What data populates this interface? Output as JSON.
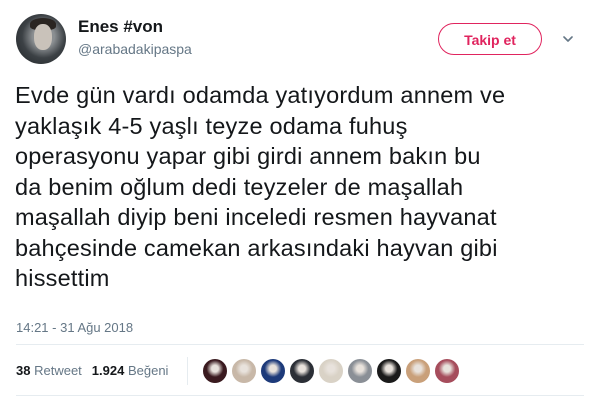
{
  "user": {
    "name": "Enes #von",
    "handle": "@arabadakipaspa"
  },
  "follow_label": "Takip et",
  "tweet_text": "Evde gün vardı odamda yatıyordum annem ve\nyaklaşık 4-5 yaşlı teyze odama fuhuş\noperasyonu yapar gibi girdi annem bakın bu\nda benim oğlum dedi teyzeler de maşallah\nmaşallah diyip beni inceledi resmen hayvanat\nbahçesinde camekan arkasındaki hayvan gibi\nhissettim",
  "timestamp": "14:21 - 31 Ağu 2018",
  "stats": {
    "retweets_count": "38",
    "retweets_label": "Retweet",
    "likes_count": "1.924",
    "likes_label": "Beğeni"
  },
  "likers": [
    {
      "color": "#3a1a1f"
    },
    {
      "color": "#c8b8a8"
    },
    {
      "color": "#1d3a7a"
    },
    {
      "color": "#2b2f36"
    },
    {
      "color": "#d9d2c6"
    },
    {
      "color": "#8a8f96"
    },
    {
      "color": "#1a1a1a"
    },
    {
      "color": "#c9a07a"
    },
    {
      "color": "#a64d5c"
    }
  ],
  "colors": {
    "accent": "#e0245e",
    "muted": "#657786",
    "text": "#14171a"
  },
  "icons": {
    "menu": "chevron-down-icon"
  }
}
